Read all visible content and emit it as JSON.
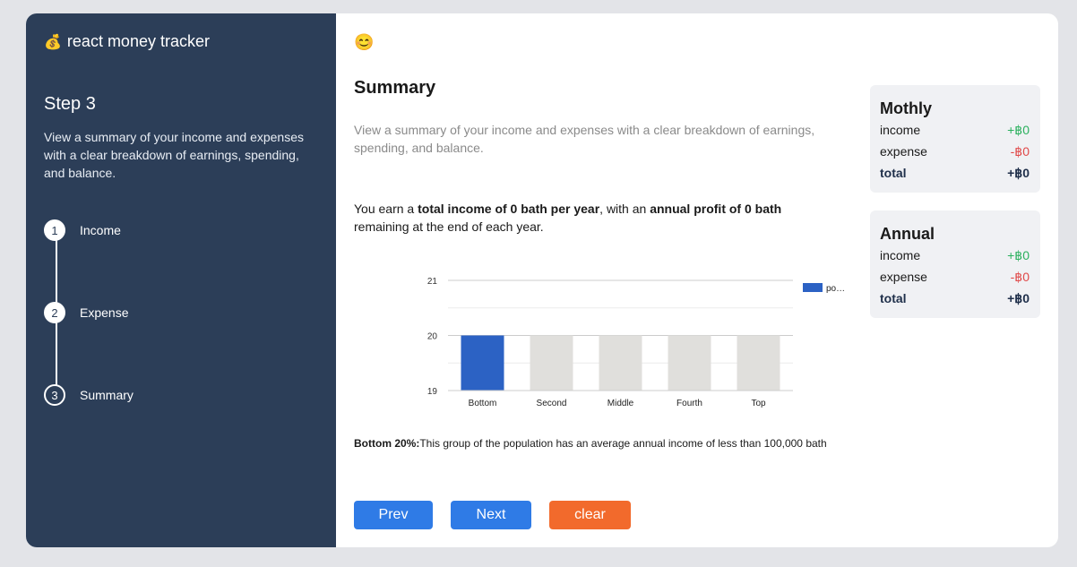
{
  "sidebar": {
    "app_icon": "money-bag-icon",
    "app_name": "react money tracker",
    "step_title": "Step 3",
    "step_description": "View a summary of your income and expenses with a clear breakdown of earnings, spending, and balance.",
    "steps": [
      {
        "number": "1",
        "label": "Income"
      },
      {
        "number": "2",
        "label": "Expense"
      },
      {
        "number": "3",
        "label": "Summary"
      }
    ]
  },
  "main": {
    "emoji": "😊",
    "title": "Summary",
    "description": "View a summary of your income and expenses with a clear breakdown of earnings, spending, and balance.",
    "earn": {
      "prefix": "You earn a ",
      "income_bold": "total income of 0 bath per year",
      "middle": ", with an ",
      "profit_bold": "annual profit of 0 bath",
      "suffix": " remaining at the end of each year."
    },
    "group": {
      "label": "Bottom 20%:",
      "text": "This group of the population has an average annual income of less than 100,000 bath"
    },
    "buttons": {
      "prev": "Prev",
      "next": "Next",
      "clear": "clear"
    }
  },
  "monthly": {
    "title": "Mothly",
    "income_label": "income",
    "income_value": "+฿0",
    "expense_label": "expense",
    "expense_value": "-฿0",
    "total_label": "total",
    "total_value": "+฿0"
  },
  "annual": {
    "title": "Annual",
    "income_label": "income",
    "income_value": "+฿0",
    "expense_label": "expense",
    "expense_value": "-฿0",
    "total_label": "total",
    "total_value": "+฿0"
  },
  "colors": {
    "sidebar_bg": "#2c3e58",
    "primary_button": "#2f7be6",
    "clear_button": "#f26a2c",
    "highlight_bar": "#2c62c4",
    "other_bar": "#e0dfdc",
    "positive": "#2bb05e",
    "negative": "#e04848"
  },
  "chart_data": {
    "type": "bar",
    "categories": [
      "Bottom",
      "Second",
      "Middle",
      "Fourth",
      "Top"
    ],
    "series": [
      {
        "name": "po…",
        "values": [
          20,
          20,
          20,
          20,
          20
        ]
      }
    ],
    "highlighted_index": 0,
    "yticks": [
      19,
      20,
      21
    ],
    "ylim": [
      19,
      21
    ],
    "grid": true,
    "legend": "top-right"
  }
}
